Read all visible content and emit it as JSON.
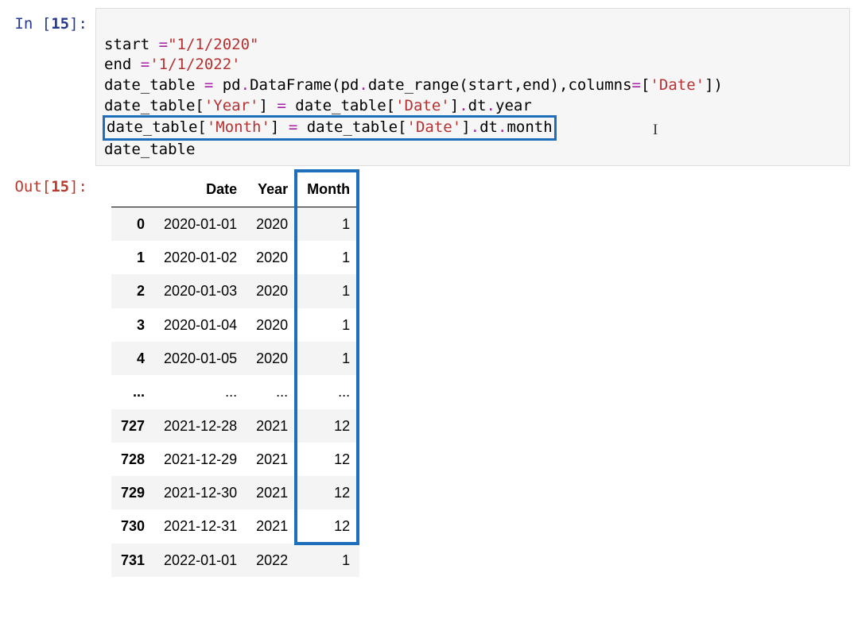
{
  "input": {
    "prompt_prefix": "In [",
    "prompt_num": "15",
    "prompt_suffix": "]:",
    "lines": {
      "l1": {
        "a": "start ",
        "op": "=",
        "str": "\"1/1/2020\""
      },
      "l2": {
        "a": "end ",
        "op": "=",
        "str": "'1/1/2022'"
      },
      "l3": {
        "a": "date_table ",
        "op1": "=",
        "b": " pd",
        "dot1": ".",
        "c": "DataFrame(pd",
        "dot2": ".",
        "d": "date_range(start,end),columns",
        "op2": "=",
        "e": "[",
        "str": "'Date'",
        "f": "])"
      },
      "l4": {
        "a": "date_table[",
        "str1": "'Year'",
        "b": "] ",
        "op": "=",
        "c": " date_table[",
        "str2": "'Date'",
        "d": "]",
        "dot": ".",
        "e": "dt",
        "dot2": ".",
        "f": "year"
      },
      "l5": {
        "a": "date_table[",
        "str1": "'Month'",
        "b": "] ",
        "op": "=",
        "c": " date_table[",
        "str2": "'Date'",
        "d": "]",
        "dot": ".",
        "e": "dt",
        "dot2": ".",
        "f": "month"
      },
      "l6": "date_table"
    }
  },
  "output": {
    "prompt_prefix": "Out[",
    "prompt_num": "15",
    "prompt_suffix": "]:",
    "columns": [
      "",
      "Date",
      "Year",
      "Month"
    ],
    "rows": [
      {
        "idx": "0",
        "date": "2020-01-01",
        "year": "2020",
        "month": "1"
      },
      {
        "idx": "1",
        "date": "2020-01-02",
        "year": "2020",
        "month": "1"
      },
      {
        "idx": "2",
        "date": "2020-01-03",
        "year": "2020",
        "month": "1"
      },
      {
        "idx": "3",
        "date": "2020-01-04",
        "year": "2020",
        "month": "1"
      },
      {
        "idx": "4",
        "date": "2020-01-05",
        "year": "2020",
        "month": "1"
      },
      {
        "idx": "...",
        "date": "...",
        "year": "...",
        "month": "..."
      },
      {
        "idx": "727",
        "date": "2021-12-28",
        "year": "2021",
        "month": "12"
      },
      {
        "idx": "728",
        "date": "2021-12-29",
        "year": "2021",
        "month": "12"
      },
      {
        "idx": "729",
        "date": "2021-12-30",
        "year": "2021",
        "month": "12"
      },
      {
        "idx": "730",
        "date": "2021-12-31",
        "year": "2021",
        "month": "12"
      },
      {
        "idx": "731",
        "date": "2022-01-01",
        "year": "2022",
        "month": "1"
      }
    ]
  },
  "cursor_glyph": "I"
}
